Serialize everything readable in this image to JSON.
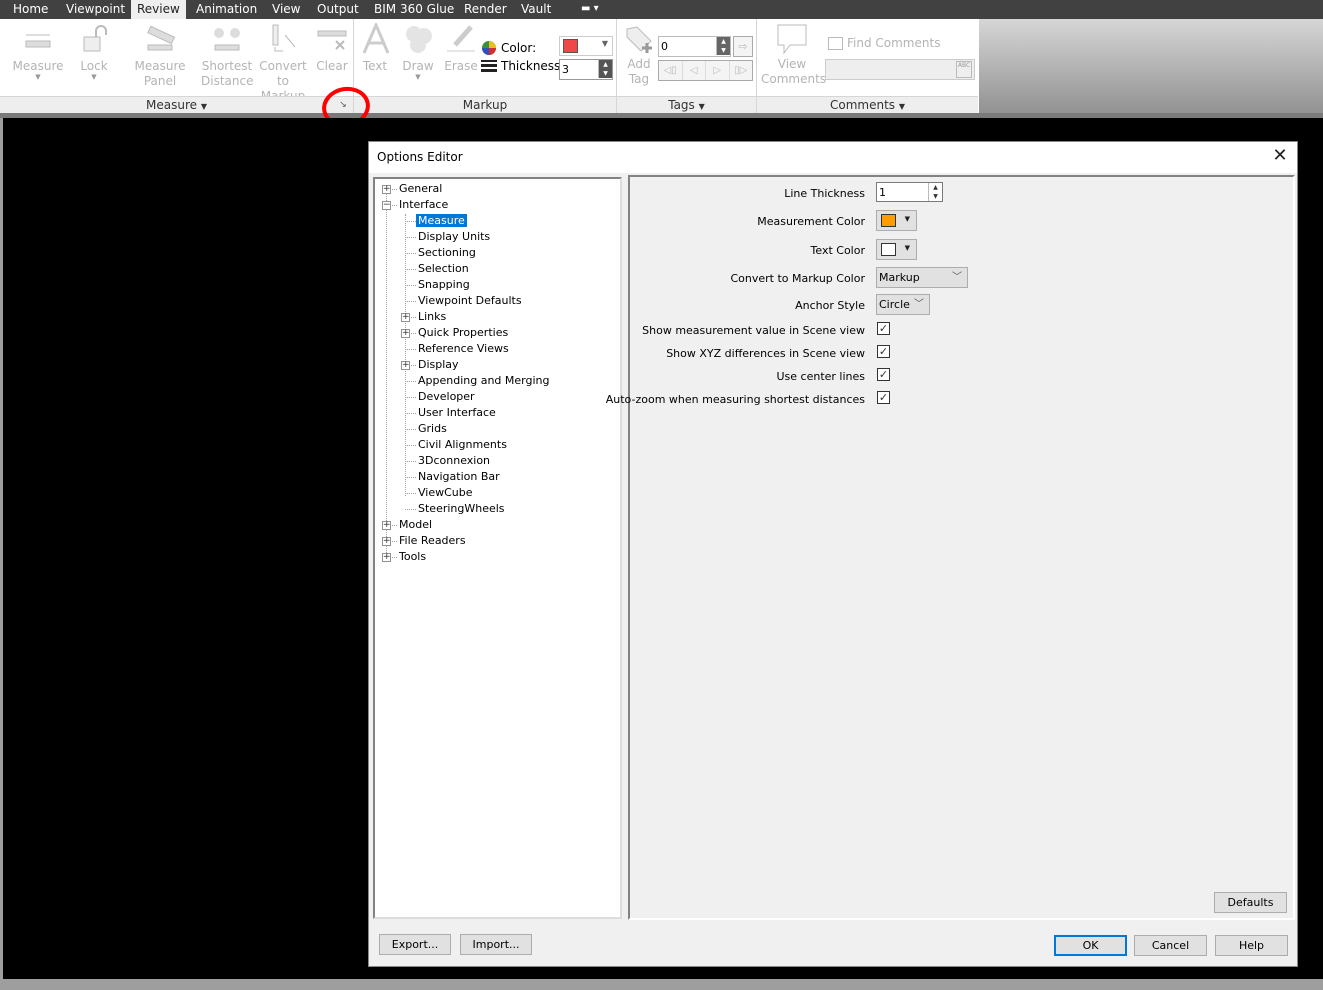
{
  "tabs": [
    {
      "label": "Home"
    },
    {
      "label": "Viewpoint"
    },
    {
      "label": "Review",
      "active": true
    },
    {
      "label": "Animation"
    },
    {
      "label": "View"
    },
    {
      "label": "Output"
    },
    {
      "label": "BIM 360 Glue"
    },
    {
      "label": "Render"
    },
    {
      "label": "Vault"
    }
  ],
  "ribbon": {
    "measure_panel": {
      "title": "Measure",
      "buttons": {
        "measure": "Measure",
        "lock": "Lock",
        "measure_panel": "Measure Panel",
        "shortest_1": "Shortest",
        "shortest_2": "Distance",
        "convert_1": "Convert",
        "convert_2": "to Markup",
        "clear": "Clear"
      }
    },
    "markup_panel": {
      "title": "Markup",
      "text": "Text",
      "draw": "Draw",
      "erase": "Erase",
      "color_label": "Color:",
      "thickness_label": "Thickness:",
      "color_value": "#f04848",
      "thickness_value": "3"
    },
    "tags_panel": {
      "title": "Tags",
      "add_1": "Add",
      "add_2": "Tag",
      "tag_value": "0"
    },
    "comments_panel": {
      "title": "Comments",
      "view_1": "View",
      "view_2": "Comments",
      "find": "Find Comments",
      "find_value": ""
    }
  },
  "dialog": {
    "title": "Options Editor",
    "tree": [
      {
        "label": "General",
        "level": 0,
        "expander": "+"
      },
      {
        "label": "Interface",
        "level": 0,
        "expander": "-"
      },
      {
        "label": "Measure",
        "level": 1,
        "selected": true
      },
      {
        "label": "Display Units",
        "level": 1
      },
      {
        "label": "Sectioning",
        "level": 1
      },
      {
        "label": "Selection",
        "level": 1
      },
      {
        "label": "Snapping",
        "level": 1
      },
      {
        "label": "Viewpoint Defaults",
        "level": 1
      },
      {
        "label": "Links",
        "level": 1,
        "expander": "+"
      },
      {
        "label": "Quick Properties",
        "level": 1,
        "expander": "+"
      },
      {
        "label": "Reference Views",
        "level": 1
      },
      {
        "label": "Display",
        "level": 1,
        "expander": "+"
      },
      {
        "label": "Appending and Merging",
        "level": 1
      },
      {
        "label": "Developer",
        "level": 1
      },
      {
        "label": "User Interface",
        "level": 1
      },
      {
        "label": "Grids",
        "level": 1
      },
      {
        "label": "Civil Alignments",
        "level": 1
      },
      {
        "label": "3Dconnexion",
        "level": 1
      },
      {
        "label": "Navigation Bar",
        "level": 1
      },
      {
        "label": "ViewCube",
        "level": 1
      },
      {
        "label": "SteeringWheels",
        "level": 1
      },
      {
        "label": "Model",
        "level": 0,
        "expander": "+"
      },
      {
        "label": "File Readers",
        "level": 0,
        "expander": "+"
      },
      {
        "label": "Tools",
        "level": 0,
        "expander": "+"
      }
    ],
    "settings": {
      "line_thickness": {
        "label": "Line Thickness",
        "value": "1"
      },
      "measurement_color": {
        "label": "Measurement Color",
        "color": "#ff9d00"
      },
      "text_color": {
        "label": "Text Color",
        "color": "#ffffff"
      },
      "convert_color": {
        "label": "Convert to Markup Color",
        "value": "Markup"
      },
      "anchor_style": {
        "label": "Anchor Style",
        "value": "Circle"
      },
      "checks": [
        {
          "label": "Show measurement value in Scene view",
          "checked": true
        },
        {
          "label": "Show XYZ differences in Scene view",
          "checked": true
        },
        {
          "label": "Use center lines",
          "checked": true
        },
        {
          "label": "Auto-zoom when measuring shortest distances",
          "checked": true
        }
      ]
    },
    "buttons": {
      "defaults": "Defaults",
      "export": "Export...",
      "import": "Import...",
      "ok": "OK",
      "cancel": "Cancel",
      "help": "Help"
    }
  }
}
